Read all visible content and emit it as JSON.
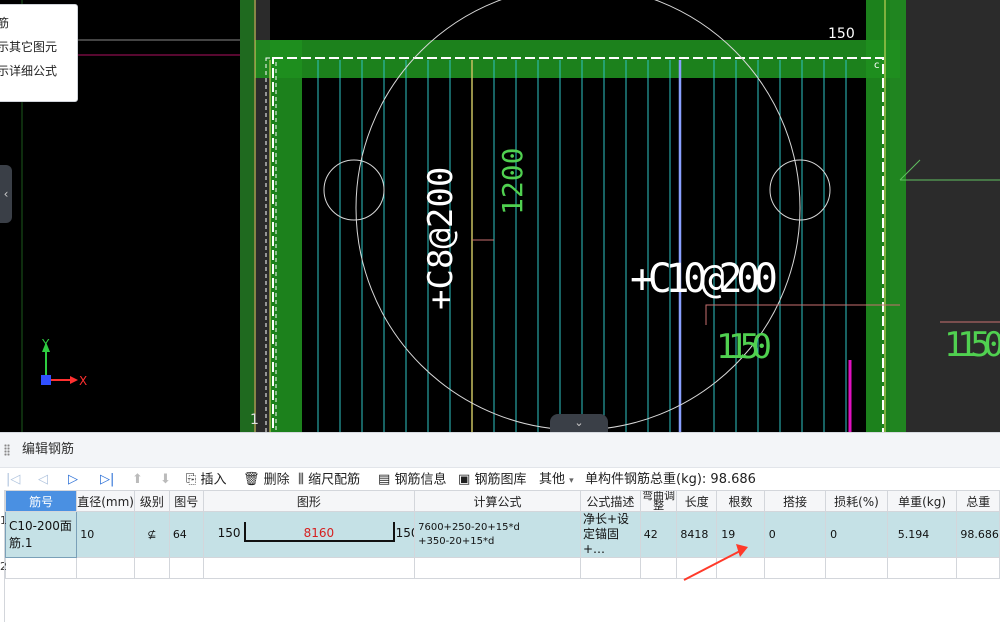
{
  "context_menu": {
    "items": [
      "筋",
      "示其它图元",
      "示详细公式"
    ]
  },
  "cad": {
    "dim_top": "150",
    "rebar_label_left": "+C8@200",
    "rebar_label_center": "+C10@200",
    "dim_vertical": "1200",
    "dim_1150_center": "1150",
    "dim_1150_right": "1150",
    "corner_number": "1",
    "axis_y": "Y",
    "axis_x": "X"
  },
  "panel": {
    "title": "编辑钢筋",
    "toolbar": {
      "insert": "插入",
      "delete": "删除",
      "scale_rebar": "缩尺配筋",
      "rebar_info": "钢筋信息",
      "rebar_library": "钢筋图库",
      "other": "其他",
      "total_label": "单构件钢筋总重(kg): 98.686"
    },
    "columns": [
      "筋号",
      "直径(mm)",
      "级别",
      "图号",
      "图形",
      "计算公式",
      "公式描述",
      "弯曲调整",
      "长度",
      "根数",
      "搭接",
      "损耗(%)",
      "单重(kg)",
      "总重"
    ],
    "rows": [
      {
        "index": "1",
        "name": "C10-200面筋.1",
        "diameter": "10",
        "grade": "⊈",
        "figure_no": "64",
        "shape_left": "150",
        "shape_mid": "8160",
        "shape_right": "150",
        "formula_line1": "7600+250-20+15*d",
        "formula_line2": "+350-20+15*d",
        "desc": "净长+设定锚固+…",
        "bend": "42",
        "length": "8418",
        "count": "19",
        "lap": "0",
        "loss": "0",
        "unit_weight": "5.194",
        "total_weight": "98.686"
      },
      {
        "index": "2"
      }
    ]
  },
  "colors": {
    "cad_bg": "#000000",
    "green_beam": "#1f8f1f",
    "rebar_line": "#2ec4c4",
    "selected_row": "#c5e1e6",
    "header_selected": "#4a90e2",
    "arrow": "#ff3a2a"
  }
}
